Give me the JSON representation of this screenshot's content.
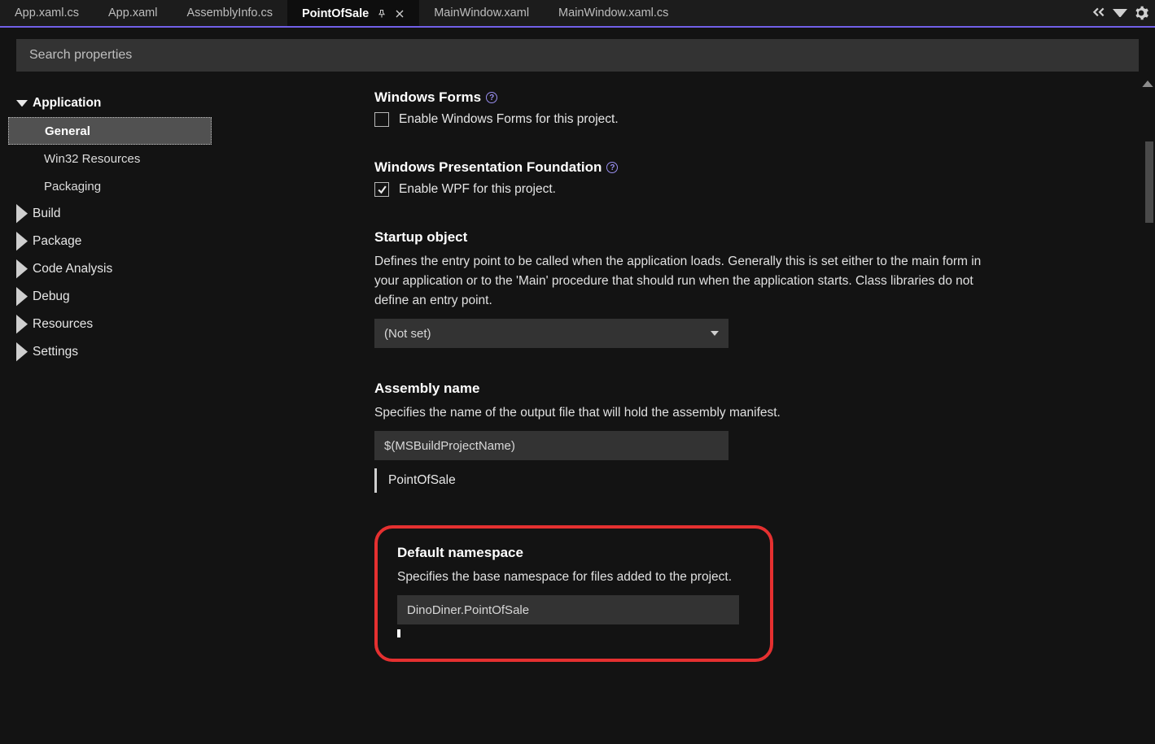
{
  "tabs": [
    {
      "label": "App.xaml.cs",
      "active": false
    },
    {
      "label": "App.xaml",
      "active": false
    },
    {
      "label": "AssemblyInfo.cs",
      "active": false
    },
    {
      "label": "PointOfSale",
      "active": true
    },
    {
      "label": "MainWindow.xaml",
      "active": false
    },
    {
      "label": "MainWindow.xaml.cs",
      "active": false
    }
  ],
  "search": {
    "placeholder": "Search properties"
  },
  "sidebar": {
    "groups": [
      {
        "label": "Application",
        "expanded": true,
        "items": [
          {
            "label": "General",
            "selected": true
          },
          {
            "label": "Win32 Resources"
          },
          {
            "label": "Packaging"
          }
        ]
      },
      {
        "label": "Build"
      },
      {
        "label": "Package"
      },
      {
        "label": "Code Analysis"
      },
      {
        "label": "Debug"
      },
      {
        "label": "Resources"
      },
      {
        "label": "Settings"
      }
    ]
  },
  "content": {
    "winForms": {
      "title": "Windows Forms",
      "checkbox_label": "Enable Windows Forms for this project.",
      "checked": false
    },
    "wpf": {
      "title": "Windows Presentation Foundation",
      "checkbox_label": "Enable WPF for this project.",
      "checked": true
    },
    "startup": {
      "title": "Startup object",
      "desc": "Defines the entry point to be called when the application loads. Generally this is set either to the main form in your application or to the 'Main' procedure that should run when the application starts. Class libraries do not define an entry point.",
      "value": "(Not set)"
    },
    "assembly": {
      "title": "Assembly name",
      "desc": "Specifies the name of the output file that will hold the assembly manifest.",
      "value": "$(MSBuildProjectName)",
      "resolved": "PointOfSale"
    },
    "namespace": {
      "title": "Default namespace",
      "desc": "Specifies the base namespace for files added to the project.",
      "value": "DinoDiner.PointOfSale"
    }
  }
}
